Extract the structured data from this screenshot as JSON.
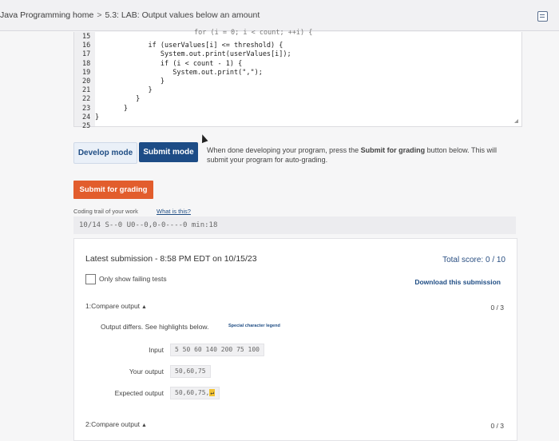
{
  "breadcrumb": {
    "course": "Java Programming home",
    "separator": ">",
    "page": "5.3: LAB: Output values below an amount"
  },
  "code": {
    "cut_line": "for (i = 0; i < count; ++i) {",
    "line_numbers": "15\n16\n17\n18\n19\n20\n21\n22\n23\n24\n25",
    "text": "\n             if (userValues[i] <= threshold) {\n                System.out.print(userValues[i]);\n                if (i < count - 1) {\n                   System.out.print(\",\");\n                }\n             }\n          }\n       }\n}\n"
  },
  "modes": {
    "develop_label": "Develop mode",
    "submit_label": "Submit mode",
    "note_prefix": "When done developing your program, press the ",
    "note_bold": "Submit for grading",
    "note_suffix": " button below. This will submit your program for auto-grading."
  },
  "submit_button": "Submit for grading",
  "trail": {
    "label": "Coding trail of your work",
    "link": "What is this?",
    "value": "10/14 S--0 U0--0,0-0----0 min:18"
  },
  "results": {
    "latest_submission": "Latest submission - 8:58 PM EDT on 10/15/23",
    "total_score": "Total score: 0 / 10",
    "only_failing_label": "Only show failing tests",
    "download_label": "Download this submission",
    "tests": [
      {
        "title": "1:Compare output",
        "score": "0 / 3",
        "differs_text": "Output differs. See highlights below.",
        "legend_link": "Special character legend",
        "input_label": "Input",
        "input_value": "5 50 60 140 200 75 100",
        "your_output_label": "Your output",
        "your_output_value": "50,60,75",
        "expected_label": "Expected output",
        "expected_value": "50,60,75,",
        "expected_newline_glyph": "↵"
      },
      {
        "title": "2:Compare output",
        "score": "0 / 3"
      }
    ]
  },
  "colors": {
    "submit_mode_bg": "#1d4c86",
    "submit_grading_bg": "#e25d2d",
    "highlight": "#f1c232"
  }
}
